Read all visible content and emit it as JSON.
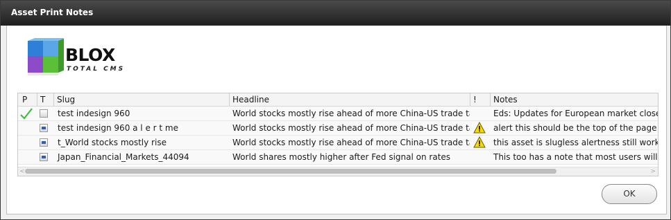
{
  "window": {
    "title": "Asset Print Notes"
  },
  "logo": {
    "name": "BLOX",
    "tagline": "TOTAL CMS"
  },
  "table": {
    "columns": {
      "p": "P",
      "t": "T",
      "slug": "Slug",
      "headline": "Headline",
      "bang": "!",
      "notes": "Notes"
    },
    "rows": [
      {
        "printed": true,
        "type_icon": "blank-doc-icon",
        "slug": "test indesign 960",
        "headline": "World stocks mostly rise ahead of more China-US trade talks",
        "warning": false,
        "notes": "Eds: Updates for European market close. W"
      },
      {
        "printed": false,
        "type_icon": "story-doc-icon",
        "slug": "test indesign 960 a l e r t me",
        "headline": "World stocks mostly rise ahead of more China-US trade talks",
        "warning": true,
        "notes": "alert this should be the top of the page"
      },
      {
        "printed": false,
        "type_icon": "story-doc-icon",
        "slug": "t_World stocks mostly rise",
        "headline": "World stocks mostly rise ahead of more China-US trade talks",
        "warning": true,
        "notes": "this asset is slugless alertness still works"
      },
      {
        "printed": false,
        "type_icon": "story-doc-icon",
        "slug": "Japan_Financial_Markets_44094",
        "headline": "World shares mostly higher after Fed signal on rates",
        "warning": false,
        "notes": "This too has a note that most users will ig"
      }
    ]
  },
  "buttons": {
    "ok": "OK"
  },
  "colors": {
    "check": "#3cbf3c",
    "warning": "#f5d90a",
    "titlebar": "#2b2b2b"
  }
}
